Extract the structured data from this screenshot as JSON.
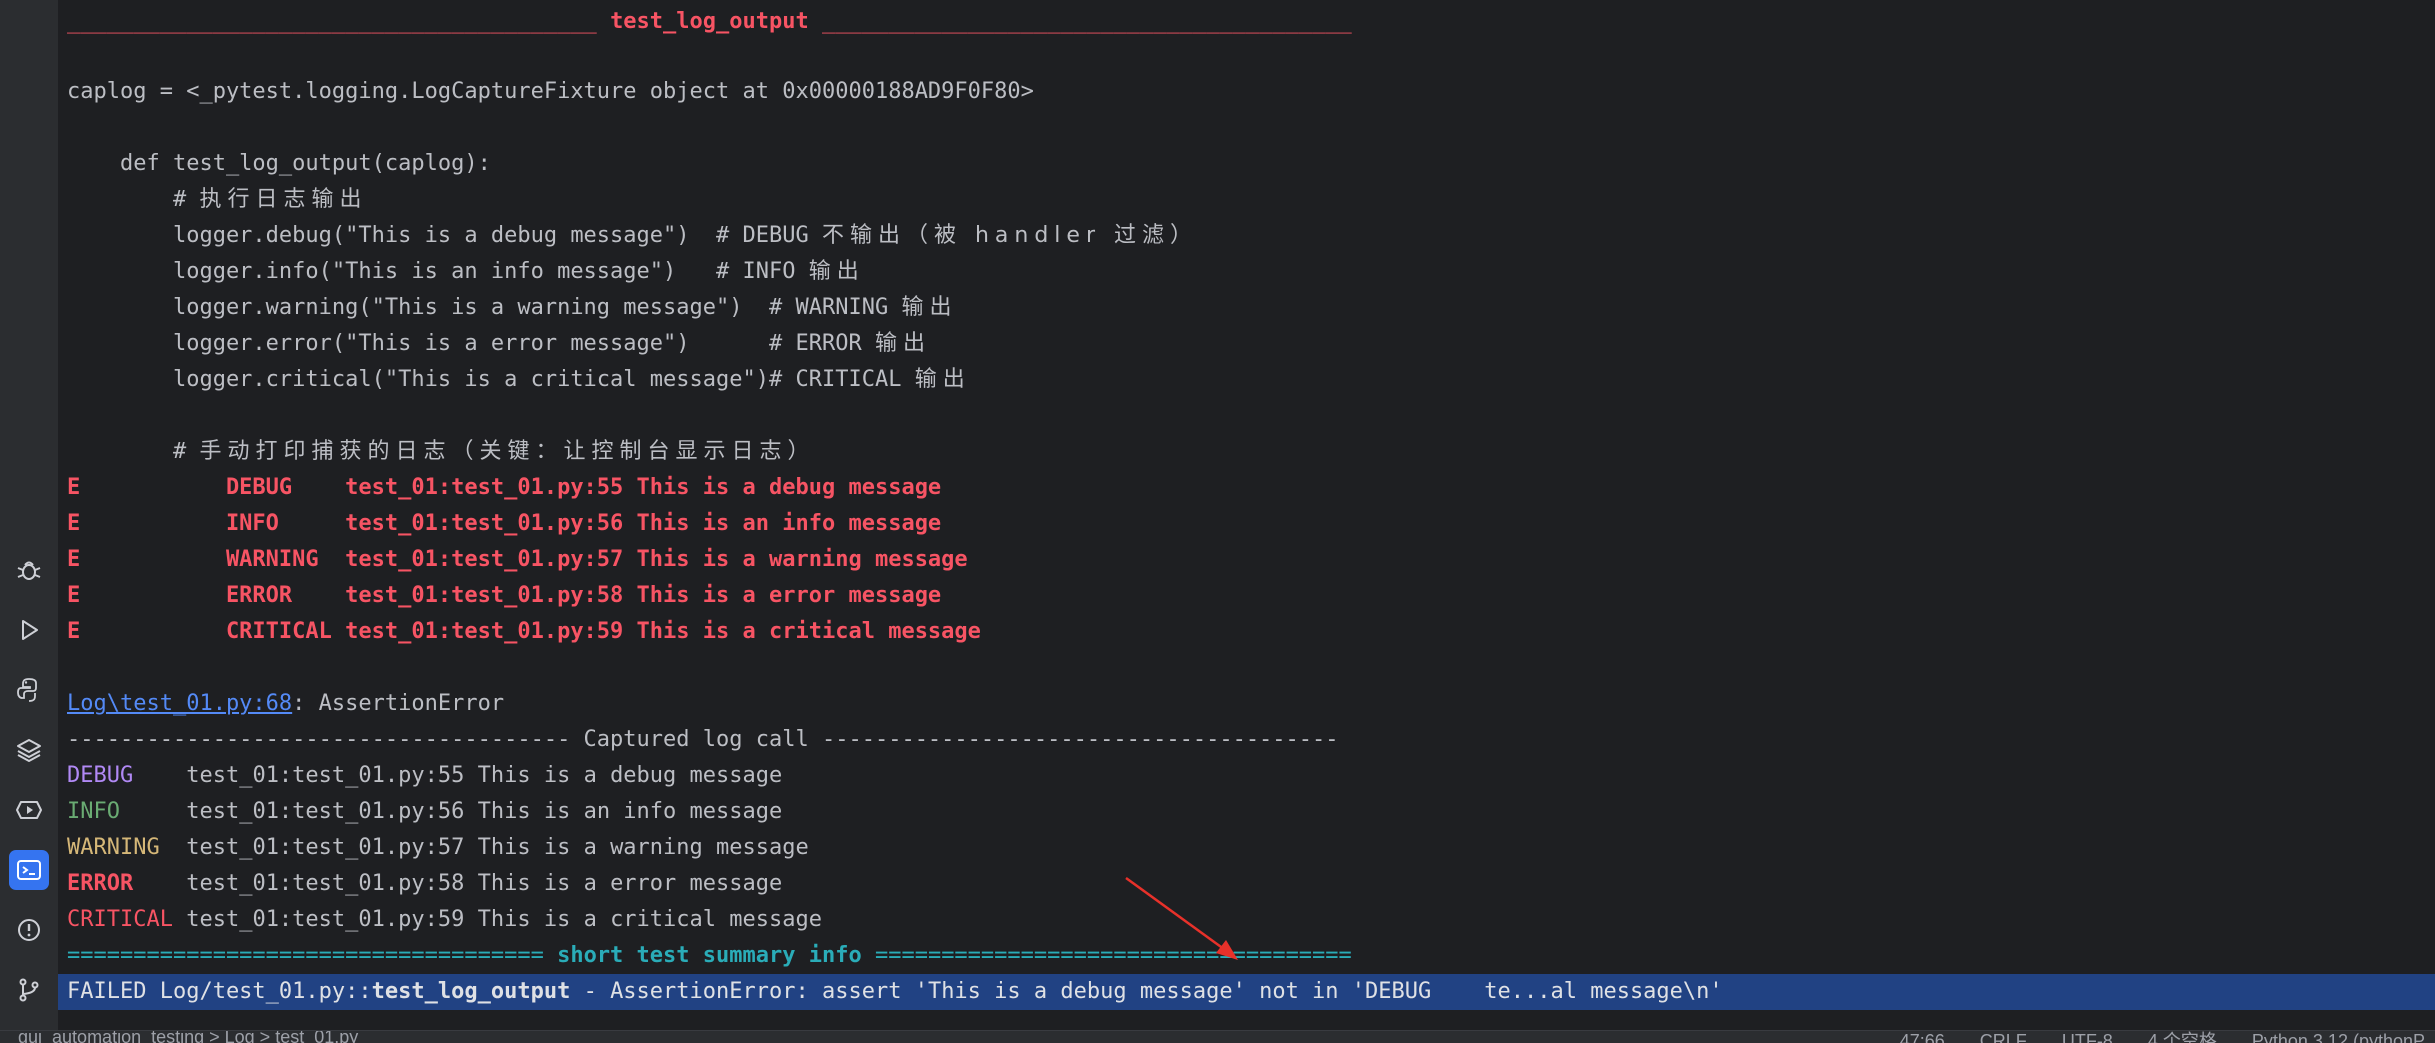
{
  "toolstrip": {
    "items": [
      {
        "name": "bug-icon",
        "active": false
      },
      {
        "name": "run-icon",
        "active": false
      },
      {
        "name": "python-icon",
        "active": false
      },
      {
        "name": "layers-icon",
        "active": false
      },
      {
        "name": "services-icon",
        "active": false
      },
      {
        "name": "terminal-icon",
        "active": true
      },
      {
        "name": "problems-icon",
        "active": false
      },
      {
        "name": "git-icon",
        "active": false
      }
    ]
  },
  "console": {
    "header_dashes_left": "________________________________________",
    "header_title": "test_log_output",
    "header_dashes_right": "________________________________________",
    "caplog_line": "caplog = <_pytest.logging.LogCaptureFixture object at 0x00000188AD9F0F80>",
    "def_line": "    def test_log_output(caplog):",
    "comment_exec_prefix": "        # ",
    "comment_exec_text": "执行日志输出",
    "code_lines": [
      {
        "code": "        logger.debug(\"This is a debug message\")  # DEBUG ",
        "cjk": "不输出（被 handler 过滤）"
      },
      {
        "code": "        logger.info(\"This is an info message\")   # INFO ",
        "cjk": "输出"
      },
      {
        "code": "        logger.warning(\"This is a warning message\")  # WARNING ",
        "cjk": "输出"
      },
      {
        "code": "        logger.error(\"This is a error message\")      # ERROR ",
        "cjk": "输出"
      },
      {
        "code": "        logger.critical(\"This is a critical message\")# CRITICAL ",
        "cjk": "输出"
      }
    ],
    "comment_print_prefix": "        # ",
    "comment_print_text": "手动打印捕获的日志（关键：让控制台显示日志）",
    "error_lines": [
      "E           DEBUG    test_01:test_01.py:55 This is a debug message",
      "E           INFO     test_01:test_01.py:56 This is an info message",
      "E           WARNING  test_01:test_01.py:57 This is a warning message",
      "E           ERROR    test_01:test_01.py:58 This is a error message",
      "E           CRITICAL test_01:test_01.py:59 This is a critical message"
    ],
    "trace_link": "Log\\test_01.py:68",
    "trace_suffix": ": AssertionError",
    "captured_header": "-------------------------------------- Captured log call ---------------------------------------",
    "captured_lines": [
      {
        "level": "DEBUG",
        "pad": "    ",
        "rest": "test_01:test_01.py:55 This is a debug message"
      },
      {
        "level": "INFO",
        "pad": "     ",
        "rest": "test_01:test_01.py:56 This is an info message"
      },
      {
        "level": "WARNING",
        "pad": "  ",
        "rest": "test_01:test_01.py:57 This is a warning message"
      },
      {
        "level": "ERROR",
        "pad": "    ",
        "rest": "test_01:test_01.py:58 This is a error message"
      },
      {
        "level": "CRITICAL",
        "pad": " ",
        "rest": "test_01:test_01.py:59 This is a critical message"
      }
    ],
    "summary_left": "==================================== ",
    "summary_title": "short test summary info",
    "summary_right": " ====================================",
    "failed_prefix": "FAILED Log/test_01.py::",
    "failed_test": "test_log_output",
    "failed_suffix": " - AssertionError: assert 'This is a debug message' not in 'DEBUG    te...al message\\n'"
  },
  "statusbar": {
    "crumbs": "gui_automation_testing  >  Log  >  test_01.py",
    "position": "47:66",
    "line_ending": "CRLF",
    "encoding": "UTF-8",
    "indent": "4 个空格",
    "interpreter": "Python 3.12 (pythonP"
  },
  "colors": {
    "background": "#1e1f22",
    "error_red": "#f75464",
    "summary_cyan": "#2aacb8",
    "selection_blue": "#214283",
    "active_tool": "#3574f0"
  }
}
